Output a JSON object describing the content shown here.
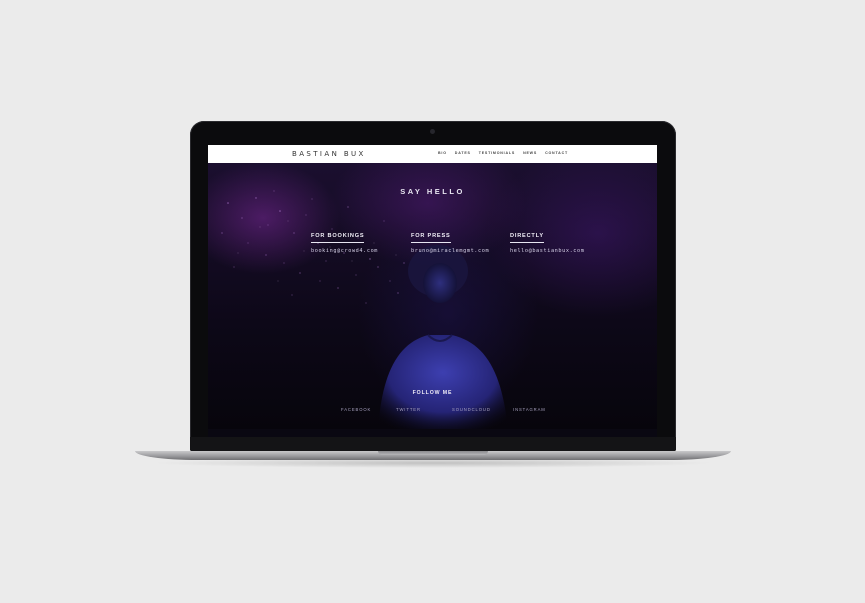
{
  "site": {
    "logo": "BASTIAN BUX",
    "nav": [
      "BIO",
      "DATES",
      "TESTIMONIALS",
      "NEWS",
      "CONTACT"
    ]
  },
  "contact": {
    "title": "SAY HELLO",
    "columns": [
      {
        "heading": "FOR BOOKINGS",
        "link": "booking@crowd4.com"
      },
      {
        "heading": "FOR PRESS",
        "link": "bruno@miraclemgmt.com"
      },
      {
        "heading": "DIRECTLY",
        "link": "hello@bastianbux.com"
      }
    ]
  },
  "follow": {
    "title": "FOLLOW ME",
    "links": [
      "FACEBOOK",
      "TWITTER",
      "SOUNDCLOUD",
      "INSTAGRAM"
    ]
  },
  "colors": {
    "background": "#ebebeb",
    "screen_dark": "#0a0812",
    "accent_purple": "#7a2a9a"
  }
}
